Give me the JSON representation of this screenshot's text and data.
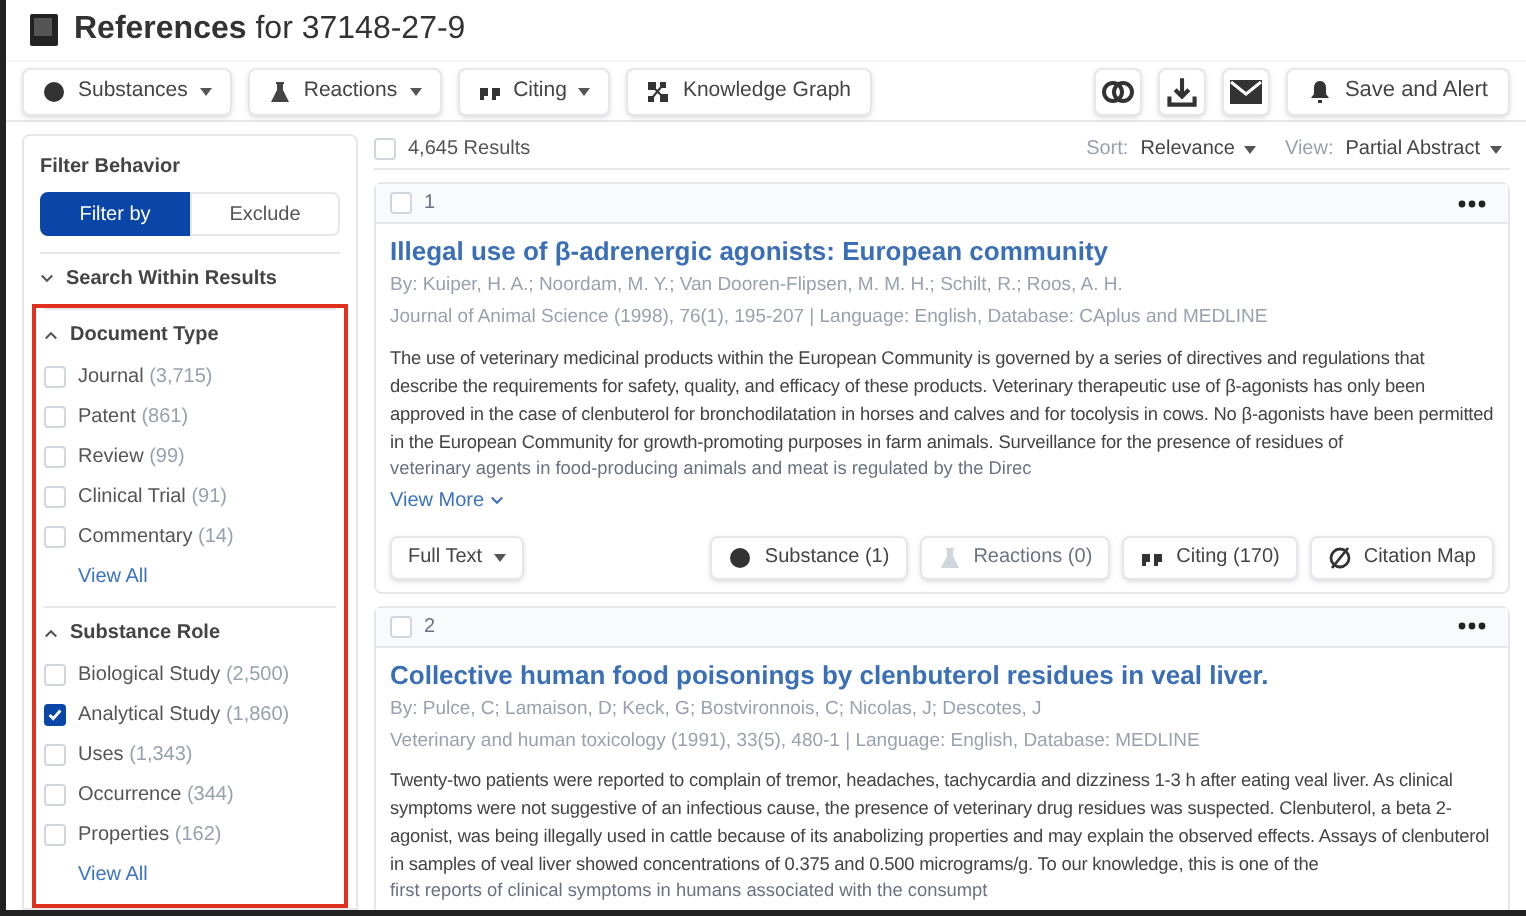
{
  "header": {
    "title": "References",
    "title_suffix": "for 37148-27-9"
  },
  "toolbar": {
    "left": [
      {
        "label": "Substances",
        "kind": "substance",
        "dropdown": true
      },
      {
        "label": "Reactions",
        "kind": "flask",
        "dropdown": true
      },
      {
        "label": "Citing",
        "kind": "quote",
        "dropdown": true
      },
      {
        "label": "Knowledge Graph",
        "kind": "graph",
        "dropdown": false
      }
    ],
    "icons": [
      {
        "kind": "rings"
      },
      {
        "kind": "download"
      },
      {
        "kind": "mail"
      }
    ],
    "save_button": "Save and Alert"
  },
  "sidebar": {
    "filter_behavior": {
      "label": "Filter Behavior",
      "options": [
        {
          "label": "Filter by",
          "selected": true
        },
        {
          "label": "Exclude",
          "selected": false
        }
      ]
    },
    "sections": [
      {
        "title": "Search Within Results",
        "expanded": false
      },
      {
        "title": "Document Type",
        "expanded": true,
        "highlighted": true,
        "items": [
          {
            "label": "Journal",
            "count": "(3,715)",
            "checked": false
          },
          {
            "label": "Patent",
            "count": "(861)",
            "checked": false
          },
          {
            "label": "Review",
            "count": "(99)",
            "checked": false
          },
          {
            "label": "Clinical Trial",
            "count": "(91)",
            "checked": false
          },
          {
            "label": "Commentary",
            "count": "(14)",
            "checked": false
          }
        ],
        "view_all": "View All"
      },
      {
        "title": "Substance Role",
        "expanded": true,
        "highlighted": true,
        "items": [
          {
            "label": "Biological Study",
            "count": "(2,500)",
            "checked": false
          },
          {
            "label": "Analytical Study",
            "count": "(1,860)",
            "checked": true
          },
          {
            "label": "Uses",
            "count": "(1,343)",
            "checked": false
          },
          {
            "label": "Occurrence",
            "count": "(344)",
            "checked": false
          },
          {
            "label": "Properties",
            "count": "(162)",
            "checked": false
          }
        ],
        "view_all": "View All"
      }
    ]
  },
  "results": {
    "select_all_checked": false,
    "count": "4,645 Results",
    "sort_label": "Sort:",
    "sort_value": "Relevance",
    "view_label": "View:",
    "view_value": "Partial Abstract",
    "items": [
      {
        "number": "1",
        "checked": false,
        "title": "Illegal use of β-adrenergic agonists: European community",
        "authors": "By: Kuiper, H. A.; Noordam, M. Y.; Van Dooren-Flipsen, M. M. H.; Schilt, R.; Roos, A. H.",
        "source": "Journal of Animal Science (1998), 76(1), 195-207 | Language: English, Database: CAplus and MEDLINE",
        "abstract": "The use of veterinary medicinal products within the European Community is governed by a series of directives and regulations that describe the requirements for safety, quality, and efficacy of these products. Veterinary therapeutic use of β-agonists has only been approved in the case of clenbuterol for bronchodilatation in horses and calves and for tocolysis in cows. No β-agonists have been permitted in the European Community for growth-promoting purposes in farm animals. Surveillance for the presence of residues of",
        "abstract_faded": "veterinary agents in food-producing animals and meat is regulated by the Direc",
        "view_more": "View More",
        "actions": [
          {
            "label": "Full Text",
            "kind": "dropdown",
            "disabled": false
          },
          {
            "label": "Substance (1)",
            "kind": "substance",
            "disabled": false
          },
          {
            "label": "Reactions (0)",
            "kind": "flask",
            "disabled": true
          },
          {
            "label": "Citing (170)",
            "kind": "quote",
            "disabled": false
          },
          {
            "label": "Citation Map",
            "kind": "map",
            "disabled": false
          }
        ]
      },
      {
        "number": "2",
        "checked": false,
        "title": "Collective human food poisonings by clenbuterol residues in veal liver.",
        "authors": "By: Pulce, C; Lamaison, D; Keck, G; Bostvironnois, C; Nicolas, J; Descotes, J",
        "source": "Veterinary and human toxicology (1991), 33(5), 480-1 | Language: English, Database: MEDLINE",
        "abstract": "Twenty-two patients were reported to complain of tremor, headaches, tachycardia and dizziness 1-3 h after eating veal liver. As clinical symptoms were not suggestive of an infectious cause, the presence of veterinary drug residues was suspected. Clenbuterol, a beta 2-agonist, was being illegally used in cattle because of its anabolizing properties and may explain the observed effects. Assays of clenbuterol in samples of veal liver showed concentrations of 0.375 and 0.500 micrograms/g. To our knowledge, this is one of the",
        "abstract_faded": "first reports of clinical symptoms in humans associated with the consumpt"
      }
    ]
  }
}
